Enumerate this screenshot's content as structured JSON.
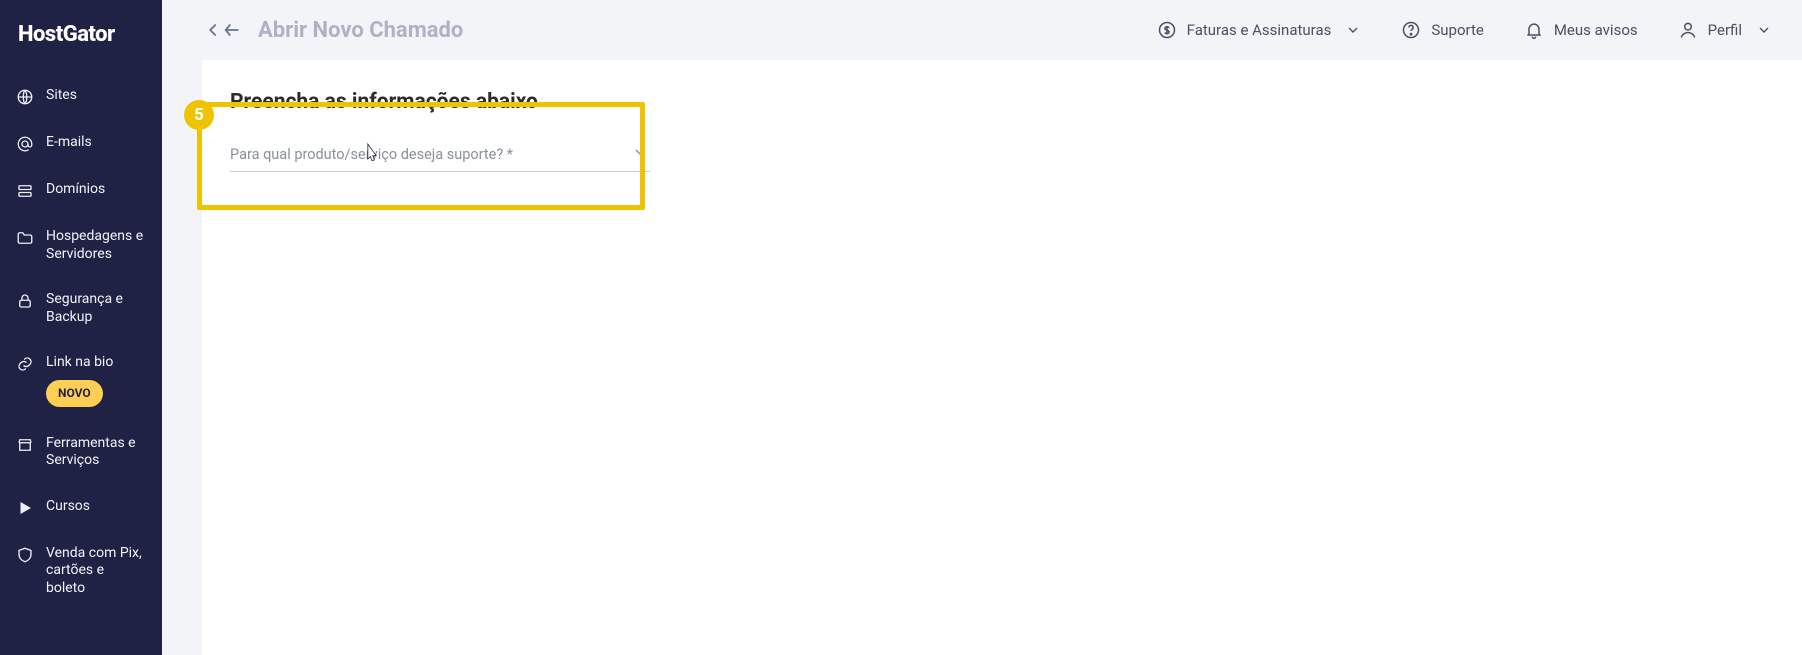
{
  "brand": {
    "name": "HostGator"
  },
  "sidebar": {
    "items": [
      {
        "label": "Sites"
      },
      {
        "label": "E-mails"
      },
      {
        "label": "Domínios"
      },
      {
        "label": "Hospedagens e Servidores"
      },
      {
        "label": "Segurança e Backup"
      },
      {
        "label": "Link na bio",
        "badge": "NOVO"
      },
      {
        "label": "Ferramentas e Serviços"
      },
      {
        "label": "Cursos"
      },
      {
        "label": "Venda com Pix, cartões e boleto"
      }
    ]
  },
  "topbar": {
    "title": "Abrir Novo Chamado",
    "links": {
      "invoices": "Faturas e Assinaturas",
      "support": "Suporte",
      "notifications": "Meus avisos",
      "profile": "Perfil"
    }
  },
  "content": {
    "heading": "Preencha as informações abaixo",
    "product_select_placeholder": "Para qual produto/serviço deseja suporte? *"
  },
  "annotation": {
    "step_number": "5"
  }
}
